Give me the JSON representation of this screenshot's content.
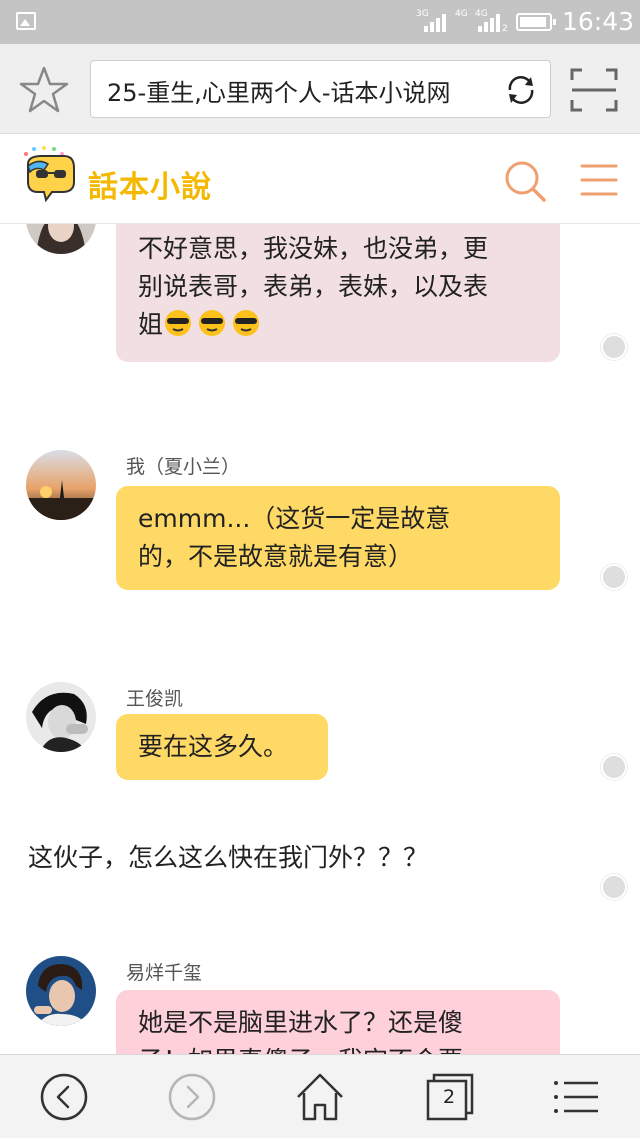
{
  "status_bar": {
    "time": "16:43",
    "net1": "3G",
    "net2": "4G",
    "net2b": "4G",
    "sim": "2"
  },
  "browser": {
    "url_text": "25-重生,心里两个人-话本小说网",
    "tab_count": "2"
  },
  "site": {
    "logo_text": "話本小說",
    "accent_color": "#f0a070",
    "logo_color": "#f5b800"
  },
  "chat": {
    "messages": [
      {
        "id": "m1",
        "sender": "",
        "lines": [
          "不好意思，我没妹，也没弟，更",
          "别说表哥，表弟，表妹，以及表",
          "姐"
        ],
        "emoji": [
          "sunglasses-emoji",
          "sunglasses-emoji",
          "sunglasses-emoji"
        ],
        "bubble_color": "#f1dfe1"
      },
      {
        "id": "m2",
        "sender": "我（夏小兰）",
        "lines": [
          "emmm...（这货一定是故意",
          "的，不是故意就是有意）"
        ],
        "bubble_color": "#ffd966"
      },
      {
        "id": "m3",
        "sender": "王俊凯",
        "lines": [
          "要在这多久。"
        ],
        "bubble_color": "#ffd966"
      },
      {
        "id": "m4",
        "sender": "易烊千玺",
        "lines": [
          "她是不是脑里进水了？还是傻",
          "子！如果真傻子，我定不会要"
        ],
        "bubble_color": "#fdd0da"
      }
    ],
    "narration": "这伙子，怎么这么快在我门外？？？"
  }
}
